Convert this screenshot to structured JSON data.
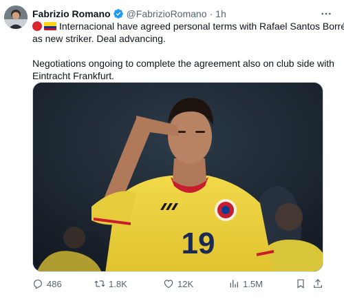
{
  "tweet": {
    "author_name": "Fabrizio Romano",
    "handle": "@FabrizioRomano",
    "separator": "·",
    "time": "1h",
    "verified_color": "#1d9bf0",
    "text_line1": "Internacional have agreed personal terms with Rafael Santos Borré",
    "text_line2": "as new striker. Deal advancing.",
    "text_line3": "Negotiations ongoing to complete the agreement also on club side with",
    "text_line4": "Eintracht Frankfurt.",
    "flags": [
      "red-circle",
      "colombia-flag"
    ],
    "media": {
      "jersey_number": "19"
    },
    "actions": {
      "reply_count": "486",
      "retweet_count": "1.8K",
      "like_count": "12K",
      "views_count": "1.5M"
    }
  }
}
